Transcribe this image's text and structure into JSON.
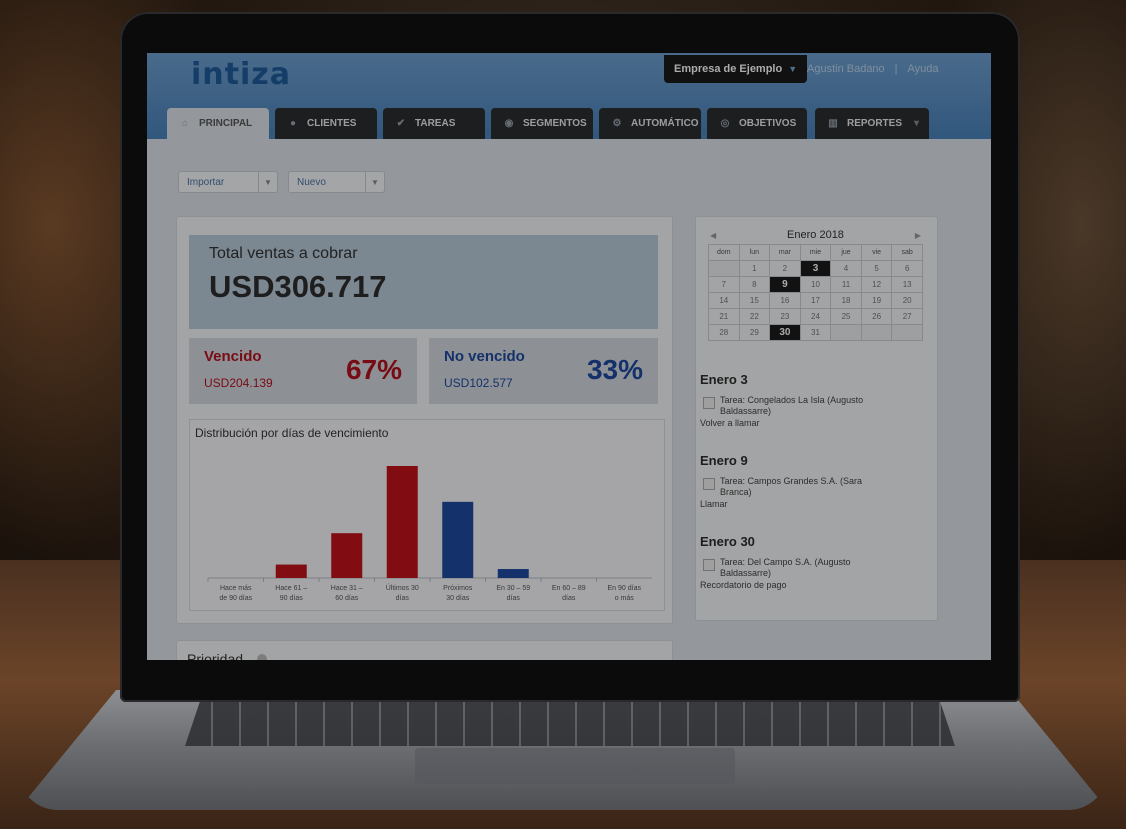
{
  "app": {
    "logo": "intiza",
    "company": "Empresa de Ejemplo",
    "user": "Agustin Badano",
    "help": "Ayuda",
    "separator": "|"
  },
  "tabs": [
    {
      "label": "PRINCIPAL",
      "icon": "home-icon"
    },
    {
      "label": "CLIENTES",
      "icon": "user-icon"
    },
    {
      "label": "TAREAS",
      "icon": "check-icon"
    },
    {
      "label": "SEGMENTOS",
      "icon": "group-icon"
    },
    {
      "label": "AUTOMÁTICO",
      "icon": "gears-icon"
    },
    {
      "label": "OBJETIVOS",
      "icon": "target-icon"
    },
    {
      "label": "REPORTES",
      "icon": "bar-chart-icon"
    }
  ],
  "toolbar": {
    "import_label": "Importar",
    "new_label": "Nuevo"
  },
  "summary": {
    "total_label": "Total ventas a cobrar",
    "total_value": "USD306.717",
    "overdue": {
      "title": "Vencido",
      "amount": "USD204.139",
      "pct": "67%",
      "color": "#b3121e"
    },
    "not_overdue": {
      "title": "No vencido",
      "amount": "USD102.577",
      "pct": "33%",
      "color": "#1f4aa0"
    }
  },
  "chart_data": {
    "type": "bar",
    "title": "Distribución por días de vencimiento",
    "categories": [
      [
        "Hace más",
        "de 90 días"
      ],
      [
        "Hace 61 –",
        "90 días"
      ],
      [
        "Hace 31 –",
        "60 días"
      ],
      [
        "Últimos 30",
        "días"
      ],
      [
        "Próximos",
        "30 días"
      ],
      [
        "En 30 – 59",
        "días"
      ],
      [
        "En 60 – 89",
        "días"
      ],
      [
        "En 90 días",
        "o más"
      ]
    ],
    "values": [
      0,
      12,
      40,
      100,
      68,
      8,
      0,
      0
    ],
    "colors": [
      "#c0121c",
      "#c0121c",
      "#c0121c",
      "#c0121c",
      "#1f4aa0",
      "#1f4aa0",
      "#1f4aa0",
      "#1f4aa0"
    ],
    "ylim": [
      0,
      100
    ],
    "grid": false,
    "legend": "none"
  },
  "calendar": {
    "title": "Enero 2018",
    "prev": "◀",
    "next": "▶",
    "weekdays": [
      "dom",
      "lun",
      "mar",
      "mie",
      "jue",
      "vie",
      "sab"
    ],
    "weeks": [
      [
        "",
        "1",
        "2",
        "3",
        "4",
        "5",
        "6"
      ],
      [
        "7",
        "8",
        "9",
        "10",
        "11",
        "12",
        "13"
      ],
      [
        "14",
        "15",
        "16",
        "17",
        "18",
        "19",
        "20"
      ],
      [
        "21",
        "22",
        "23",
        "24",
        "25",
        "26",
        "27"
      ],
      [
        "28",
        "29",
        "30",
        "31",
        "",
        "",
        ""
      ]
    ],
    "highlighted": [
      "3",
      "9",
      "30"
    ]
  },
  "agenda": [
    {
      "date": "Enero 3",
      "task": "Tarea: Congelados La Isla (Augusto Baldassarre)",
      "note": "Volver a llamar"
    },
    {
      "date": "Enero 9",
      "task": "Tarea: Campos Grandes S.A. (Sara Branca)",
      "note": "Llamar"
    },
    {
      "date": "Enero 30",
      "task": "Tarea: Del Campo S.A. (Augusto Baldassarre)",
      "note": "Recordatorio de pago"
    }
  ],
  "priority": {
    "label": "Prioridad"
  }
}
